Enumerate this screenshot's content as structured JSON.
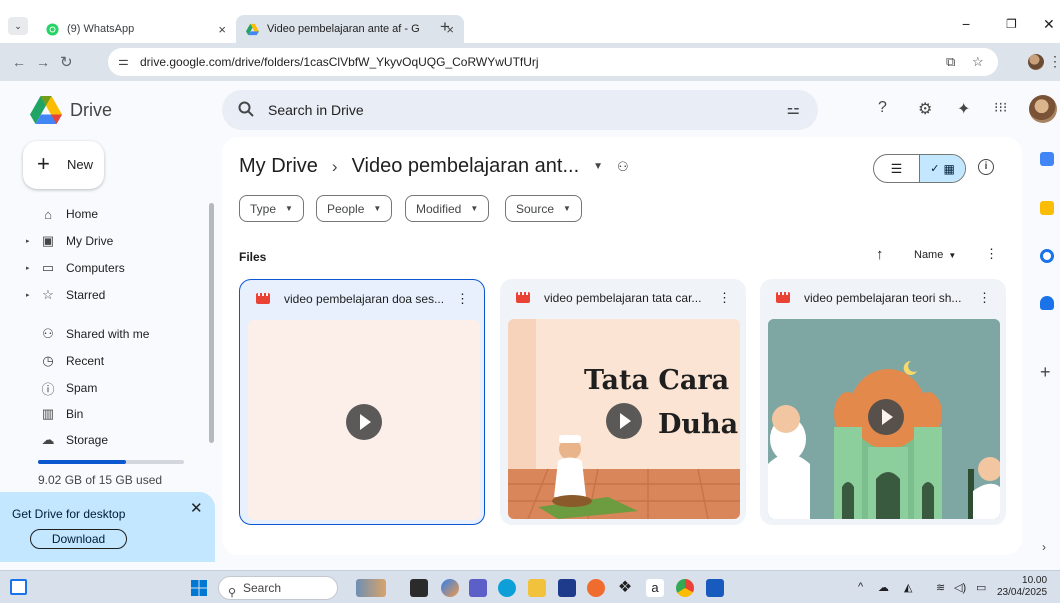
{
  "browser": {
    "tabs": [
      {
        "label": "(9) WhatsApp",
        "active": false
      },
      {
        "label": "Video pembelajaran ante af - G",
        "active": true
      }
    ],
    "url_host": "drive.google.com",
    "url_path": "/drive/folders/1casClVbfW_YkyvOqUQG_CoRWYwUTfUrj"
  },
  "drive": {
    "app_name": "Drive",
    "search_placeholder": "Search in Drive",
    "new_label": "New"
  },
  "sidebar": {
    "items": [
      {
        "label": "Home",
        "icon": "home-icon"
      },
      {
        "label": "My Drive",
        "icon": "my-drive-icon"
      },
      {
        "label": "Computers",
        "icon": "computers-icon"
      },
      {
        "label": "Starred",
        "icon": "star-icon"
      },
      {
        "label": "Shared with me",
        "icon": "shared-icon"
      },
      {
        "label": "Recent",
        "icon": "clock-icon"
      },
      {
        "label": "Spam",
        "icon": "spam-icon"
      },
      {
        "label": "Bin",
        "icon": "trash-icon"
      },
      {
        "label": "Storage",
        "icon": "cloud-icon"
      }
    ],
    "storage_text": "9.02 GB of 15 GB used",
    "storage_used_fraction": 0.6,
    "promo_title": "Get Drive for desktop",
    "promo_button": "Download"
  },
  "main": {
    "breadcrumb_root": "My Drive",
    "breadcrumb_current": "Video pembelajaran ant...",
    "filters": [
      "Type",
      "People",
      "Modified",
      "Source"
    ],
    "section_label": "Files",
    "sort_label": "Name",
    "files": [
      {
        "title": "video pembelajaran doa ses...",
        "thumbnail_text_1": "",
        "thumbnail_text_2": ""
      },
      {
        "title": "video pembelajaran tata car...",
        "thumbnail_text_1": "Tata Cara S",
        "thumbnail_text_2": "Duha"
      },
      {
        "title": "video pembelajaran teori sh...",
        "thumbnail_text_1": "",
        "thumbnail_text_2": ""
      }
    ]
  },
  "taskbar": {
    "search_label": "Search",
    "time": "10.00",
    "date": "23/04/2025"
  },
  "colors": {
    "accent": "#0b57d0",
    "selected_bg": "#c2e7ff",
    "video_icon": "#ea4335"
  }
}
